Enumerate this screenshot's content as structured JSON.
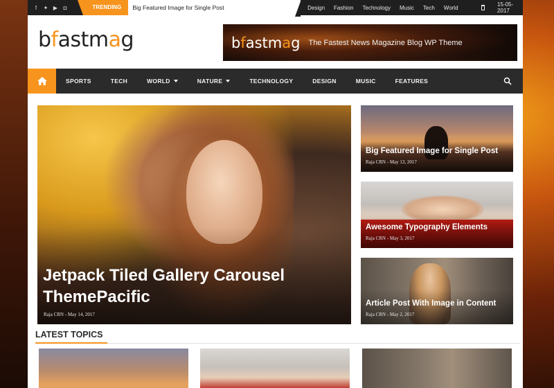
{
  "topbar": {
    "social_icons": [
      "facebook-icon",
      "twitter-icon",
      "youtube-icon",
      "instagram-icon"
    ],
    "trending_label": "TRENDING",
    "trending_text": "Big Featured Image for Single Post",
    "links": [
      "Design",
      "Fashion",
      "Technology",
      "Music",
      "Tech",
      "World"
    ],
    "date": "15-05-2017"
  },
  "header": {
    "logo_parts": [
      "b",
      "f",
      "astm",
      "a",
      "g"
    ],
    "banner_tagline": "The Fastest News Magazine Blog WP Theme"
  },
  "nav": {
    "items": [
      "SPORTS",
      "TECH",
      "WORLD",
      "NATURE",
      "TECHNOLOGY",
      "DESIGN",
      "MUSIC",
      "FEATURES"
    ]
  },
  "hero": {
    "title": "Jetpack Tiled Gallery Carousel ThemePacific",
    "author": "Raja CRN",
    "separator": "-",
    "date": "May 14, 2017"
  },
  "side_posts": [
    {
      "title": "Big Featured Image for Single Post",
      "author": "Raja CRN",
      "date": "May 13, 2017"
    },
    {
      "title": "Awesome Typography Elements",
      "author": "Raja CRN",
      "date": "May 3, 2017"
    },
    {
      "title": "Article Post With Image in Content",
      "author": "Raja CRN",
      "date": "May 2, 2017"
    }
  ],
  "latest": {
    "heading": "LATEST TOPICS"
  },
  "colors": {
    "accent": "#f7941d",
    "dark_bar": "#1f1f1f",
    "nav_bg": "#2b2b2b"
  }
}
